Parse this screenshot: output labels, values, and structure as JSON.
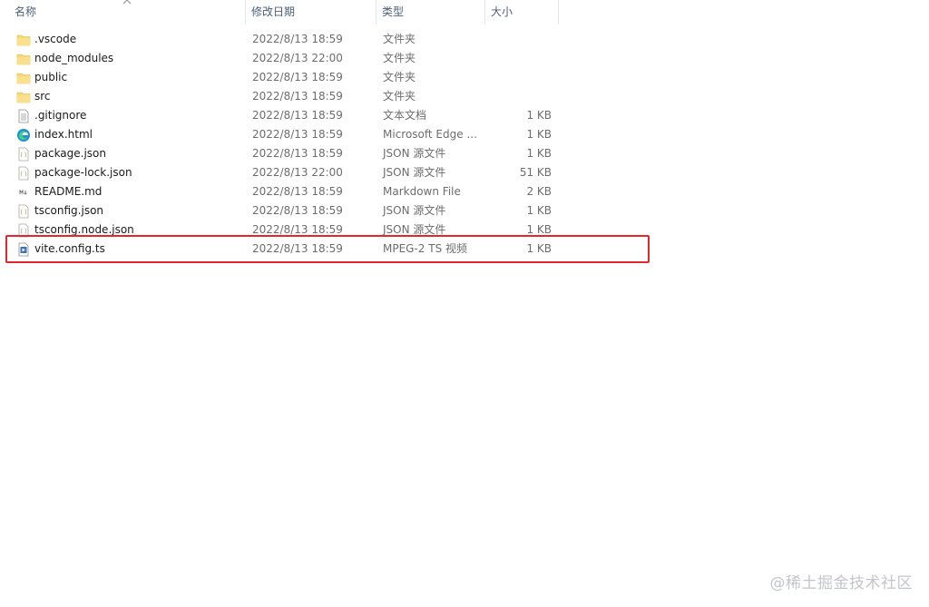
{
  "header": {
    "name": "名称",
    "date": "修改日期",
    "type": "类型",
    "size": "大小"
  },
  "files": [
    {
      "name": ".vscode",
      "date": "2022/8/13 18:59",
      "type": "文件夹",
      "size": "",
      "icon": "folder-icon"
    },
    {
      "name": "node_modules",
      "date": "2022/8/13 22:00",
      "type": "文件夹",
      "size": "",
      "icon": "folder-icon"
    },
    {
      "name": "public",
      "date": "2022/8/13 18:59",
      "type": "文件夹",
      "size": "",
      "icon": "folder-icon"
    },
    {
      "name": "src",
      "date": "2022/8/13 18:59",
      "type": "文件夹",
      "size": "",
      "icon": "folder-icon"
    },
    {
      "name": ".gitignore",
      "date": "2022/8/13 18:59",
      "type": "文本文档",
      "size": "1 KB",
      "icon": "text-file-icon"
    },
    {
      "name": "index.html",
      "date": "2022/8/13 18:59",
      "type": "Microsoft Edge ...",
      "size": "1 KB",
      "icon": "edge-icon"
    },
    {
      "name": "package.json",
      "date": "2022/8/13 18:59",
      "type": "JSON 源文件",
      "size": "1 KB",
      "icon": "json-file-icon"
    },
    {
      "name": "package-lock.json",
      "date": "2022/8/13 22:00",
      "type": "JSON 源文件",
      "size": "51 KB",
      "icon": "json-file-icon"
    },
    {
      "name": "README.md",
      "date": "2022/8/13 18:59",
      "type": "Markdown File",
      "size": "2 KB",
      "icon": "markdown-file-icon"
    },
    {
      "name": "tsconfig.json",
      "date": "2022/8/13 18:59",
      "type": "JSON 源文件",
      "size": "1 KB",
      "icon": "json-file-icon"
    },
    {
      "name": "tsconfig.node.json",
      "date": "2022/8/13 18:59",
      "type": "JSON 源文件",
      "size": "1 KB",
      "icon": "json-file-icon"
    },
    {
      "name": "vite.config.ts",
      "date": "2022/8/13 18:59",
      "type": "MPEG-2 TS 视频",
      "size": "1 KB",
      "icon": "video-file-icon"
    }
  ],
  "watermark": "@稀土掘金技术社区",
  "colors": {
    "folder": "#f8d775",
    "highlight": "#e5262f",
    "header_text": "#4c607a",
    "detail_text": "#6d6d6d"
  }
}
